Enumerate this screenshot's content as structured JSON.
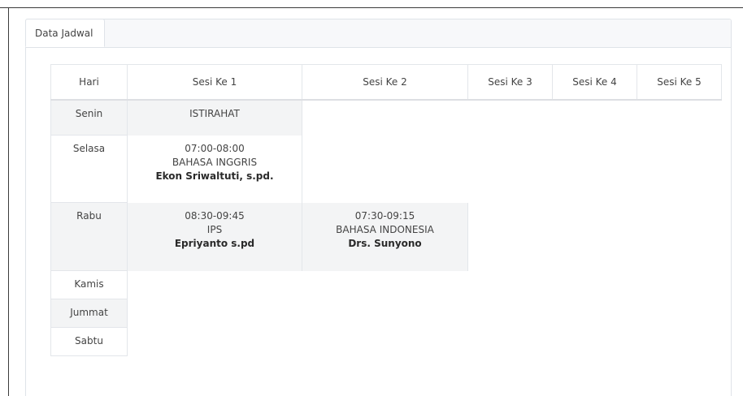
{
  "tab": {
    "label": "Data Jadwal"
  },
  "table": {
    "headers": [
      "Hari",
      "Sesi Ke 1",
      "Sesi Ke 2",
      "Sesi Ke 3",
      "Sesi Ke 4",
      "Sesi Ke 5"
    ],
    "rows": [
      {
        "day": "Senin",
        "sessions": [
          {
            "note": "ISTIRAHAT"
          }
        ]
      },
      {
        "day": "Selasa",
        "sessions": [
          {
            "time": "07:00-08:00",
            "subject": "BAHASA INGGRIS",
            "teacher": "Ekon Sriwaltuti, s.pd."
          }
        ]
      },
      {
        "day": "Rabu",
        "sessions": [
          {
            "time": "08:30-09:45",
            "subject": "IPS",
            "teacher": "Epriyanto s.pd"
          },
          {
            "time": "07:30-09:15",
            "subject": "BAHASA INDONESIA",
            "teacher": "Drs. Sunyono"
          }
        ]
      },
      {
        "day": "Kamis",
        "sessions": []
      },
      {
        "day": "Jummat",
        "sessions": []
      },
      {
        "day": "Sabtu",
        "sessions": []
      }
    ]
  },
  "colors": {
    "stripe": "#f3f4f5",
    "border": "#e3e6ea",
    "text": "#444444"
  }
}
